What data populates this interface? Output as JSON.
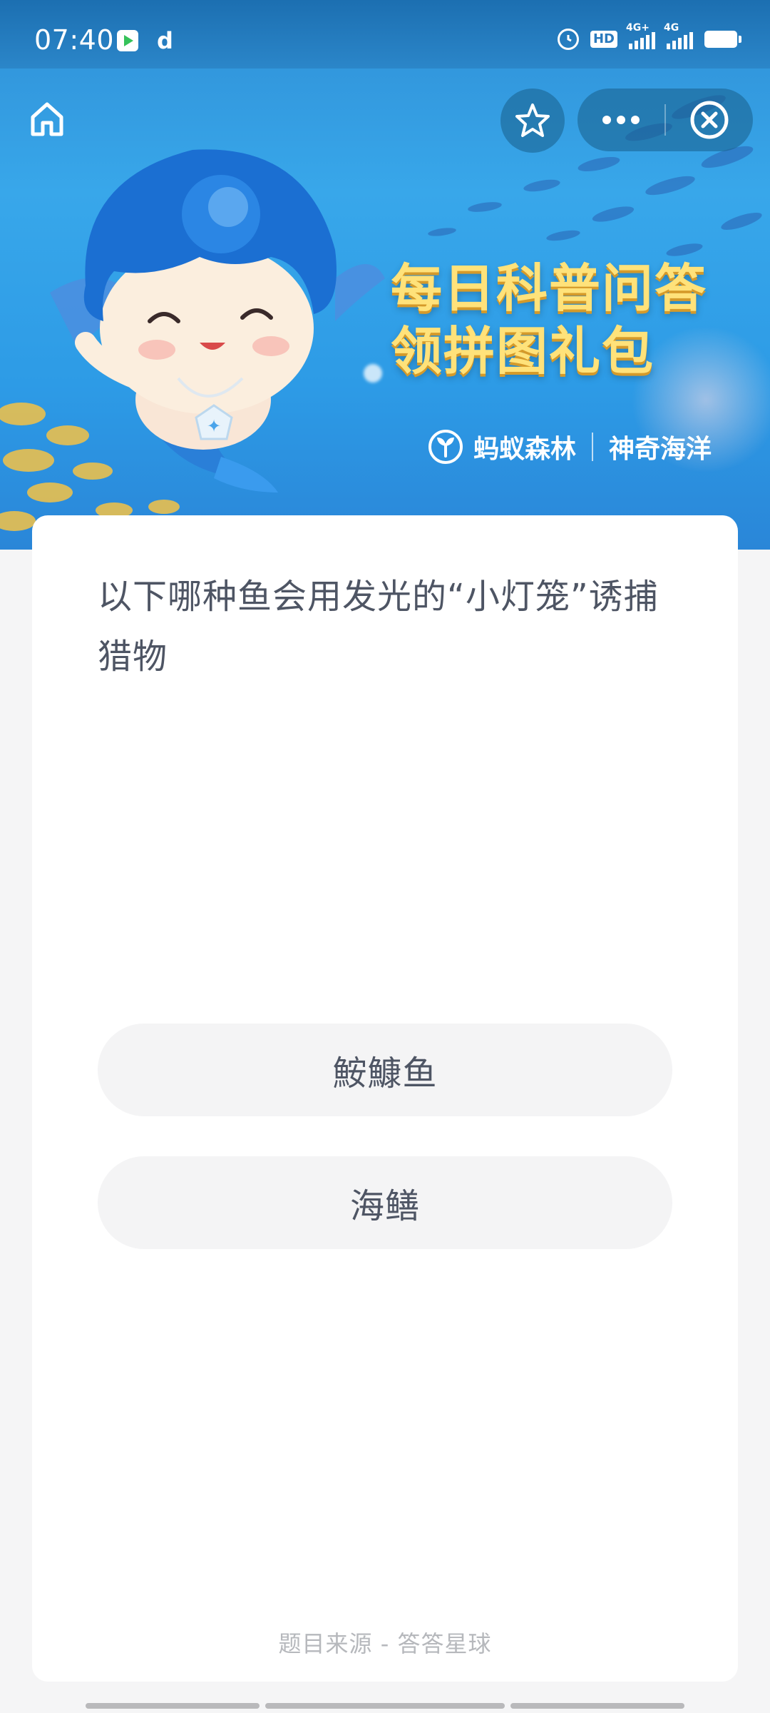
{
  "status_bar": {
    "time": "07:40",
    "left_icons": [
      "play-store-icon",
      "d-icon"
    ],
    "d_label": "d",
    "hd_label": "HD",
    "network_1": "4G+",
    "network_2": "4G"
  },
  "nav": {
    "icons": [
      "home-icon",
      "star-icon",
      "more-icon",
      "close-icon"
    ]
  },
  "banner": {
    "title_line_1": "每日科普问答",
    "title_line_2": "领拼图礼包",
    "brand_1": "蚂蚁森林",
    "brand_2": "神奇海洋"
  },
  "quiz": {
    "question": "以下哪种鱼会用发光的“小灯笼”诱捕猎物",
    "options": [
      {
        "label": "鮟鱇鱼"
      },
      {
        "label": "海鳝"
      }
    ],
    "source": "题目来源 - 答答星球"
  },
  "colors": {
    "banner_blue": "#2f9be6",
    "title_yellow": "#ffe27a",
    "text_gray": "#4e5564",
    "option_bg": "#f4f4f5",
    "page_bg": "#f5f5f6"
  }
}
